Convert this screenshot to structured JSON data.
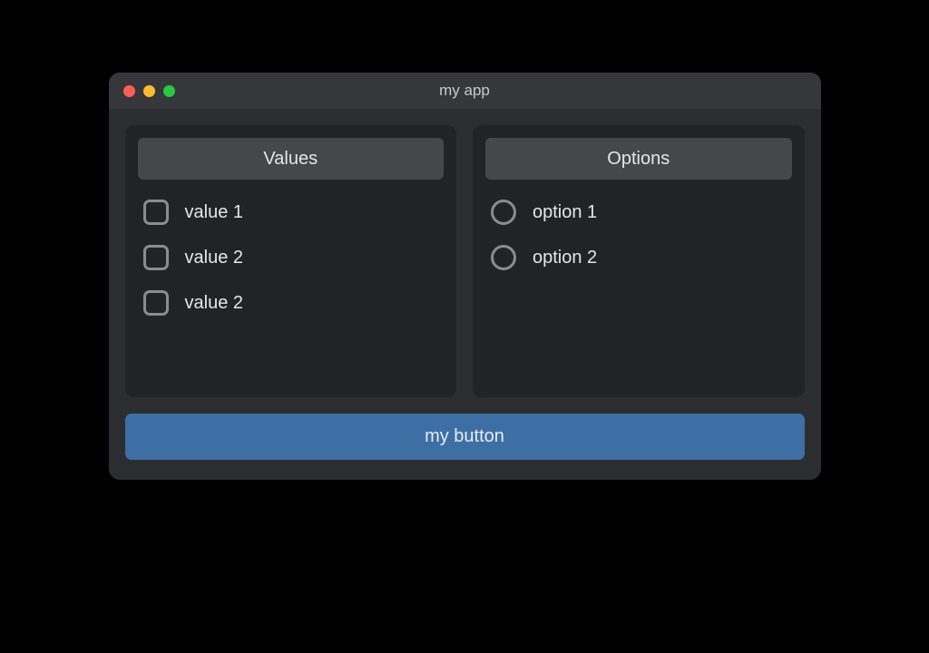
{
  "window": {
    "title": "my app"
  },
  "panels": {
    "values": {
      "header": "Values",
      "items": [
        {
          "label": "value 1"
        },
        {
          "label": "value 2"
        },
        {
          "label": "value 2"
        }
      ]
    },
    "options": {
      "header": "Options",
      "items": [
        {
          "label": "option 1"
        },
        {
          "label": "option 2"
        }
      ]
    }
  },
  "button": {
    "label": "my button"
  },
  "colors": {
    "accent": "#3d6fa5",
    "window_bg": "#2b2d30",
    "panel_bg": "#222326",
    "header_bg": "#45474a"
  }
}
